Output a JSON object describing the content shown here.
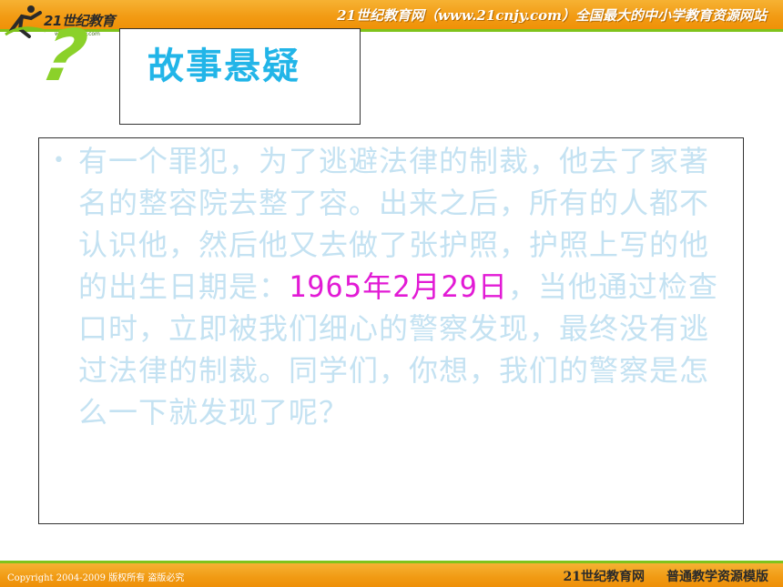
{
  "header": {
    "logo_text": "21世纪教育",
    "logo_url": "www.21cnjy.com",
    "tagline": "21世纪教育网（www.21cnjy.com）全国最大的中小学教育资源网站"
  },
  "slide": {
    "decoration_icon": "question-mark",
    "question_glyph": "?",
    "title": "故事悬疑",
    "bullet_glyph": "•",
    "story": {
      "part1": "有一个罪犯，为了逃避法律的制裁，他去了家著名的整容院去整了容。出来之后，所有的人都不认识他，然后他又去做了张护照，护照上写的他的出生日期是：",
      "highlight": "1965年2月29日",
      "part2": "，当他通过检查口时，立即被我们细心的警察发现，最终没有逃过法律的制裁。同学们，你想，我们的警察是怎么一下就发现了呢？"
    }
  },
  "footer": {
    "copyright": "Copyright 2004-2009 版权所有 盗版必究",
    "site_name": "21世纪教育网",
    "template_name": "普通教学资源模版"
  },
  "colors": {
    "header_orange": "#f29a12",
    "accent_green": "#7fc31c",
    "title_blue": "#22b5e8",
    "story_text": "#c4e2f2",
    "highlight_magenta": "#e21ad5"
  }
}
